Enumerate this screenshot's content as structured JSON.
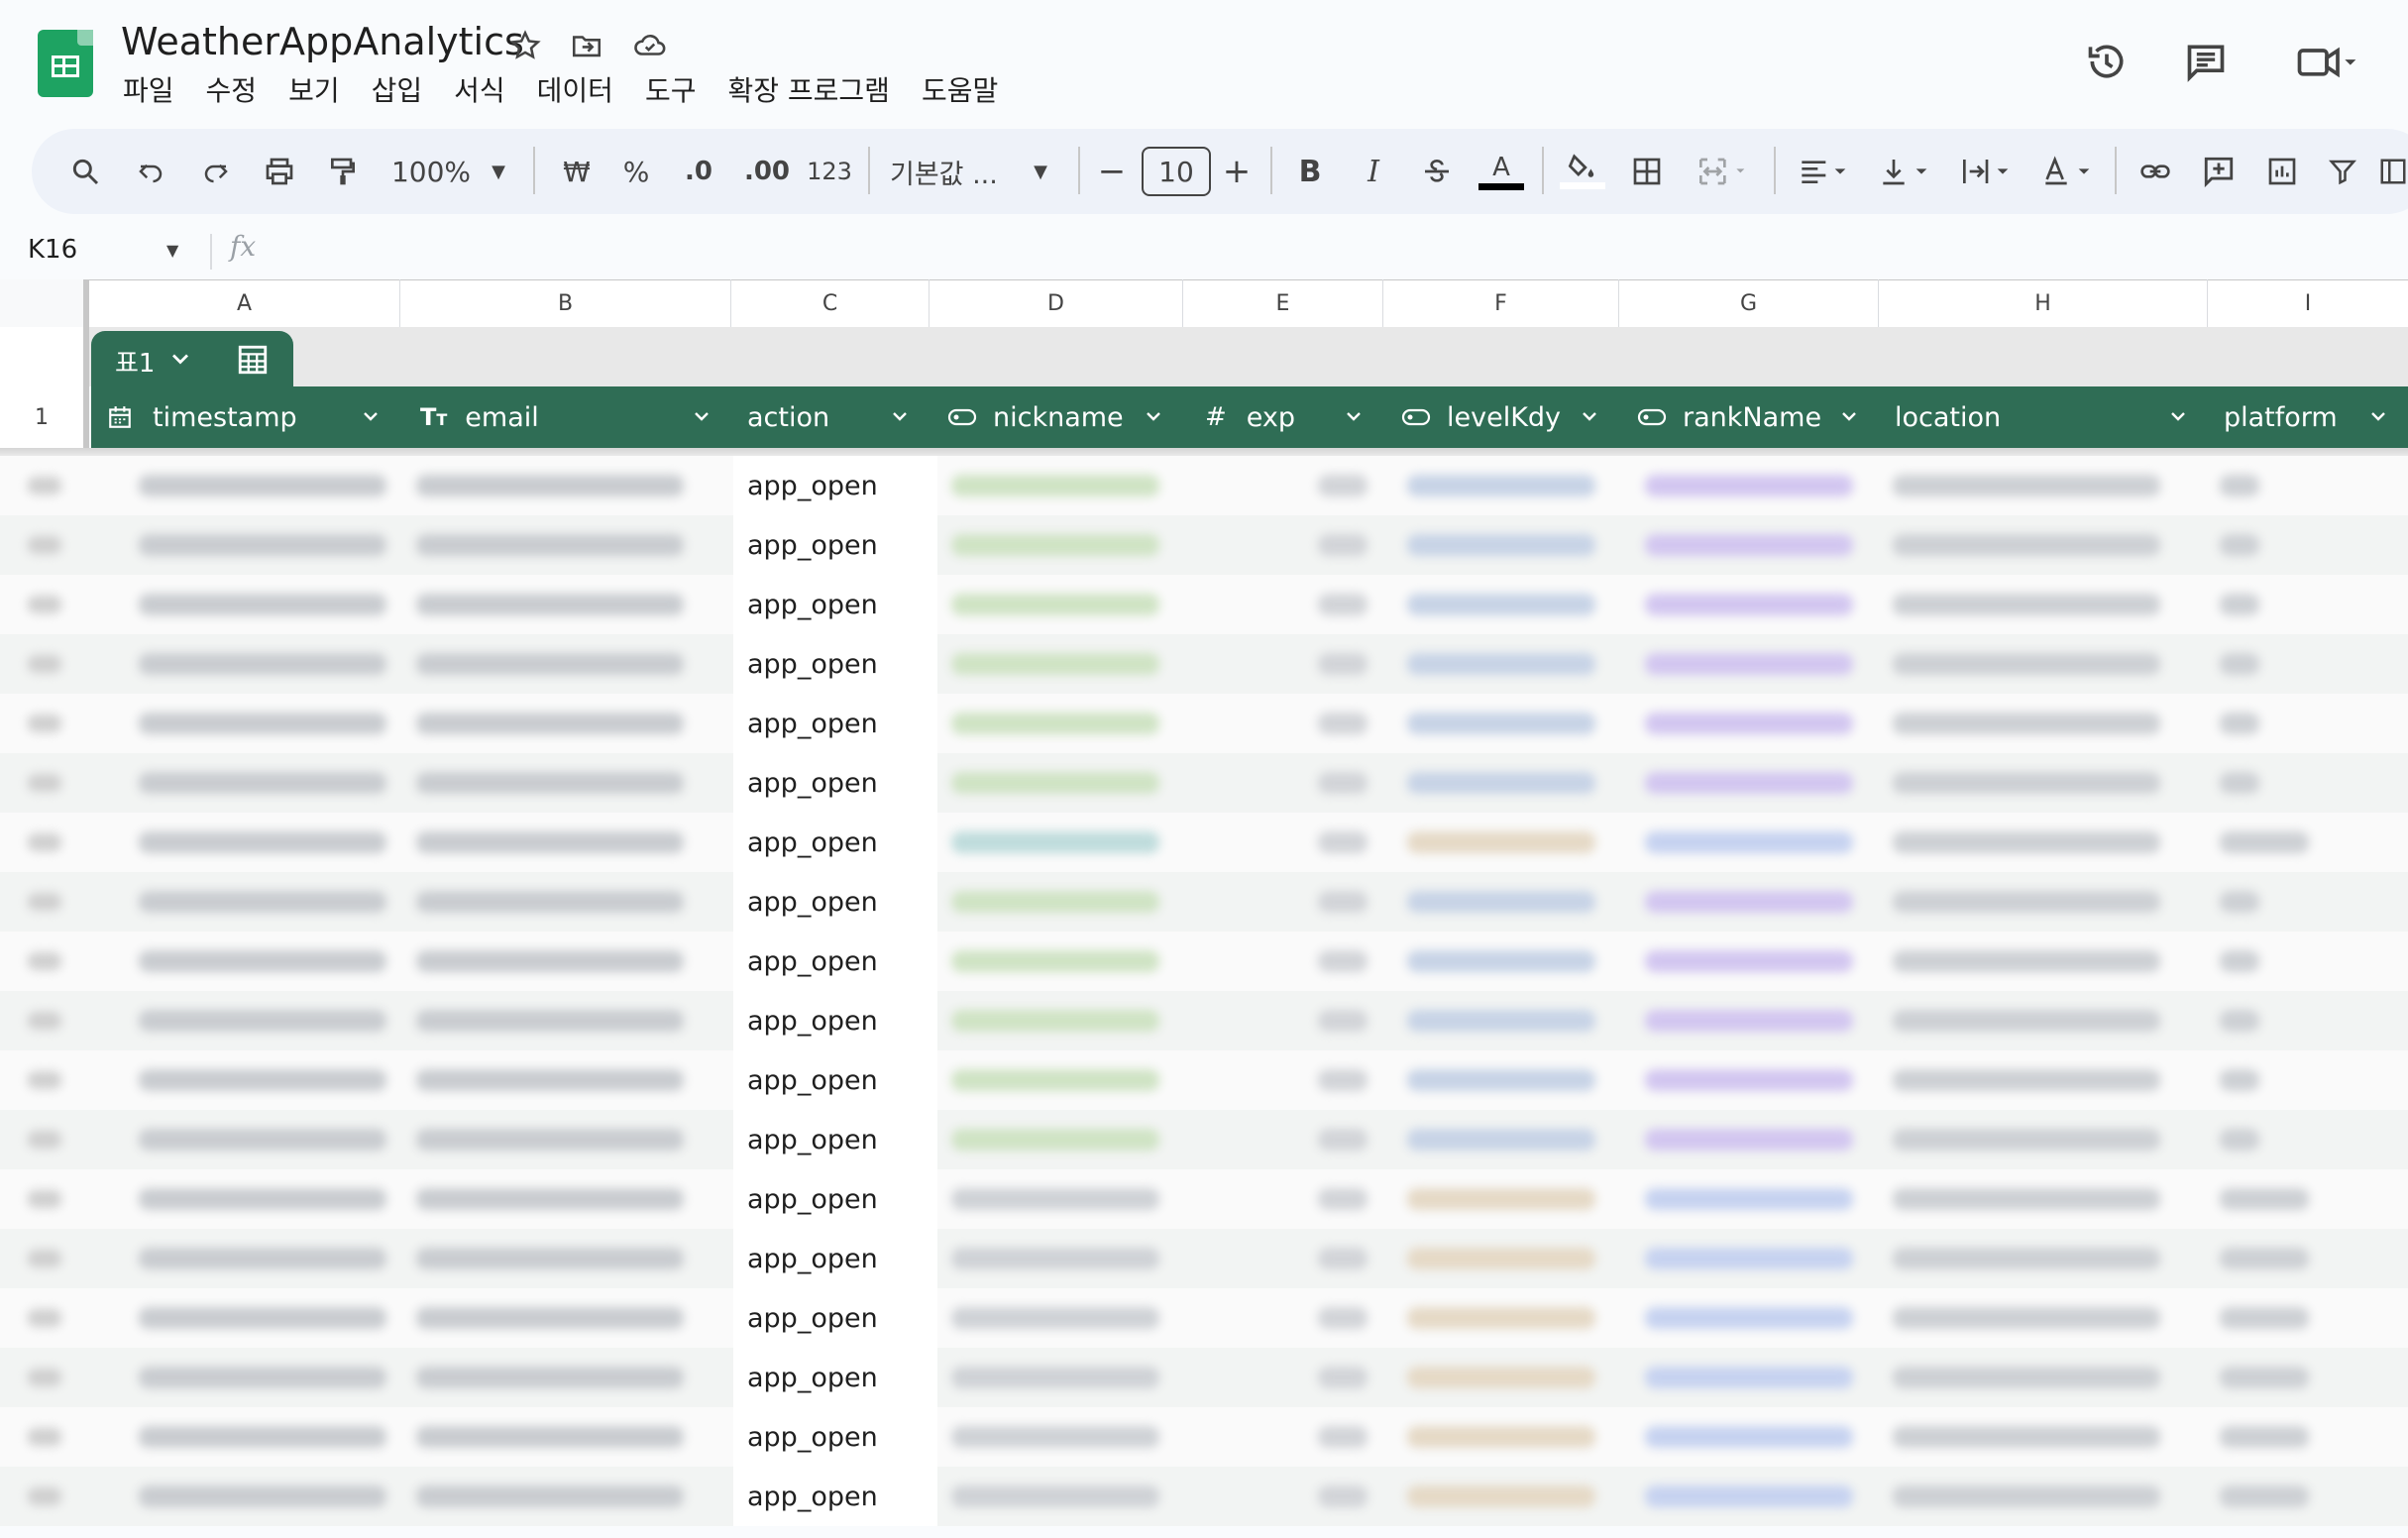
{
  "app": {
    "title": "WeatherAppAnalytics",
    "menu": [
      "파일",
      "수정",
      "보기",
      "삽입",
      "서식",
      "데이터",
      "도구",
      "확장 프로그램",
      "도움말"
    ]
  },
  "toolbar": {
    "zoom": "100%",
    "currency": "₩",
    "percent": "%",
    "dec_decrease": ".0",
    "dec_increase": ".00",
    "number_format": "123",
    "font": "기본값 ...",
    "font_size": "10",
    "bold": "B",
    "italic": "I",
    "text_color_glyph": "A"
  },
  "formula_bar": {
    "cell_ref": "K16",
    "fx": "fx"
  },
  "columns": [
    "A",
    "B",
    "C",
    "D",
    "E",
    "F",
    "G",
    "H",
    "I"
  ],
  "table": {
    "name": "표1",
    "header_row_number": "1",
    "headers": [
      "timestamp",
      "email",
      "action",
      "nickname",
      "exp",
      "levelKdy",
      "rankName",
      "location",
      "platform"
    ],
    "header_type_icons": [
      "calendar-icon",
      "text-type-icon",
      "",
      "chip-icon",
      "number-icon",
      "chip-icon",
      "chip-icon",
      "",
      ""
    ],
    "header_color": "#2f6d55",
    "action_values": [
      "app_open",
      "app_open",
      "app_open",
      "app_open",
      "app_open",
      "app_open",
      "app_open",
      "app_open",
      "app_open",
      "app_open",
      "app_open",
      "app_open",
      "app_open",
      "app_open",
      "app_open",
      "app_open",
      "app_open",
      "app_open"
    ]
  }
}
